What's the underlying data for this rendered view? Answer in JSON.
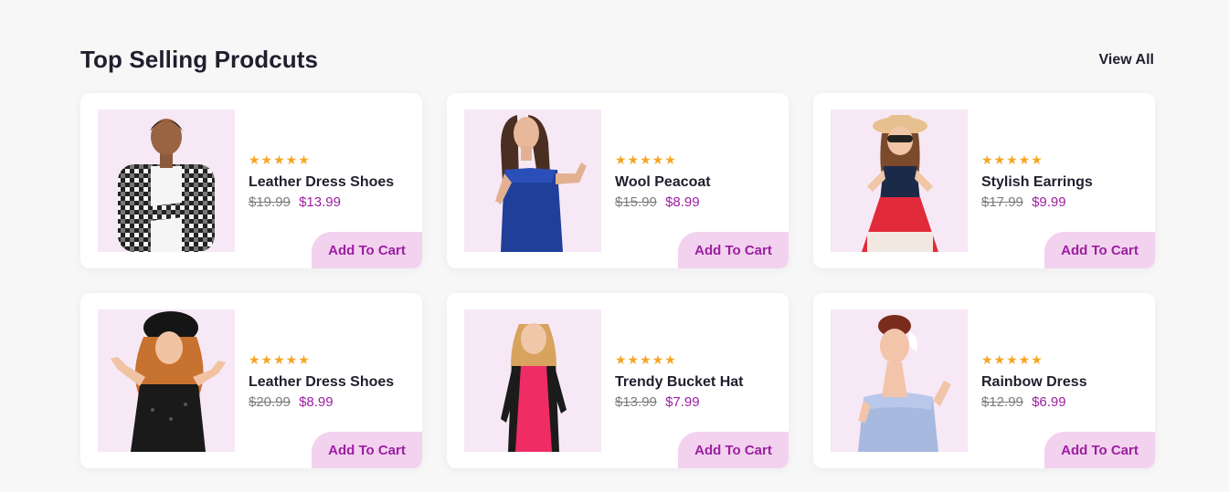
{
  "section": {
    "title": "Top Selling Prodcuts",
    "view_all": "View All"
  },
  "products": [
    {
      "rating": "★★★★★",
      "name": "Leather Dress Shoes",
      "old_price": "$19.99",
      "price": "$13.99",
      "cart_label": "Add To Cart",
      "image_icon": "plaid-shirt-man-photo"
    },
    {
      "rating": "★★★★★",
      "name": "Wool Peacoat",
      "old_price": "$15.99",
      "price": "$8.99",
      "cart_label": "Add To Cart",
      "image_icon": "blue-dress-woman-photo"
    },
    {
      "rating": "★★★★★",
      "name": "Stylish Earrings",
      "old_price": "$17.99",
      "price": "$9.99",
      "cart_label": "Add To Cart",
      "image_icon": "girl-red-dress-photo"
    },
    {
      "rating": "★★★★★",
      "name": "Leather Dress Shoes",
      "old_price": "$20.99",
      "price": "$8.99",
      "cart_label": "Add To Cart",
      "image_icon": "woman-black-hat-photo"
    },
    {
      "rating": "★★★★★",
      "name": "Trendy Bucket Hat",
      "old_price": "$13.99",
      "price": "$7.99",
      "cart_label": "Add To Cart",
      "image_icon": "girl-pink-dress-photo"
    },
    {
      "rating": "★★★★★",
      "name": "Rainbow Dress",
      "old_price": "$12.99",
      "price": "$6.99",
      "cart_label": "Add To Cart",
      "image_icon": "pinup-woman-photo"
    }
  ],
  "colors": {
    "background": "#f7f7f7",
    "accent": "#9b1fa0",
    "button_bg": "#f2d2ee",
    "thumb_bg": "#f7e8f6",
    "star": "#f5a623"
  }
}
